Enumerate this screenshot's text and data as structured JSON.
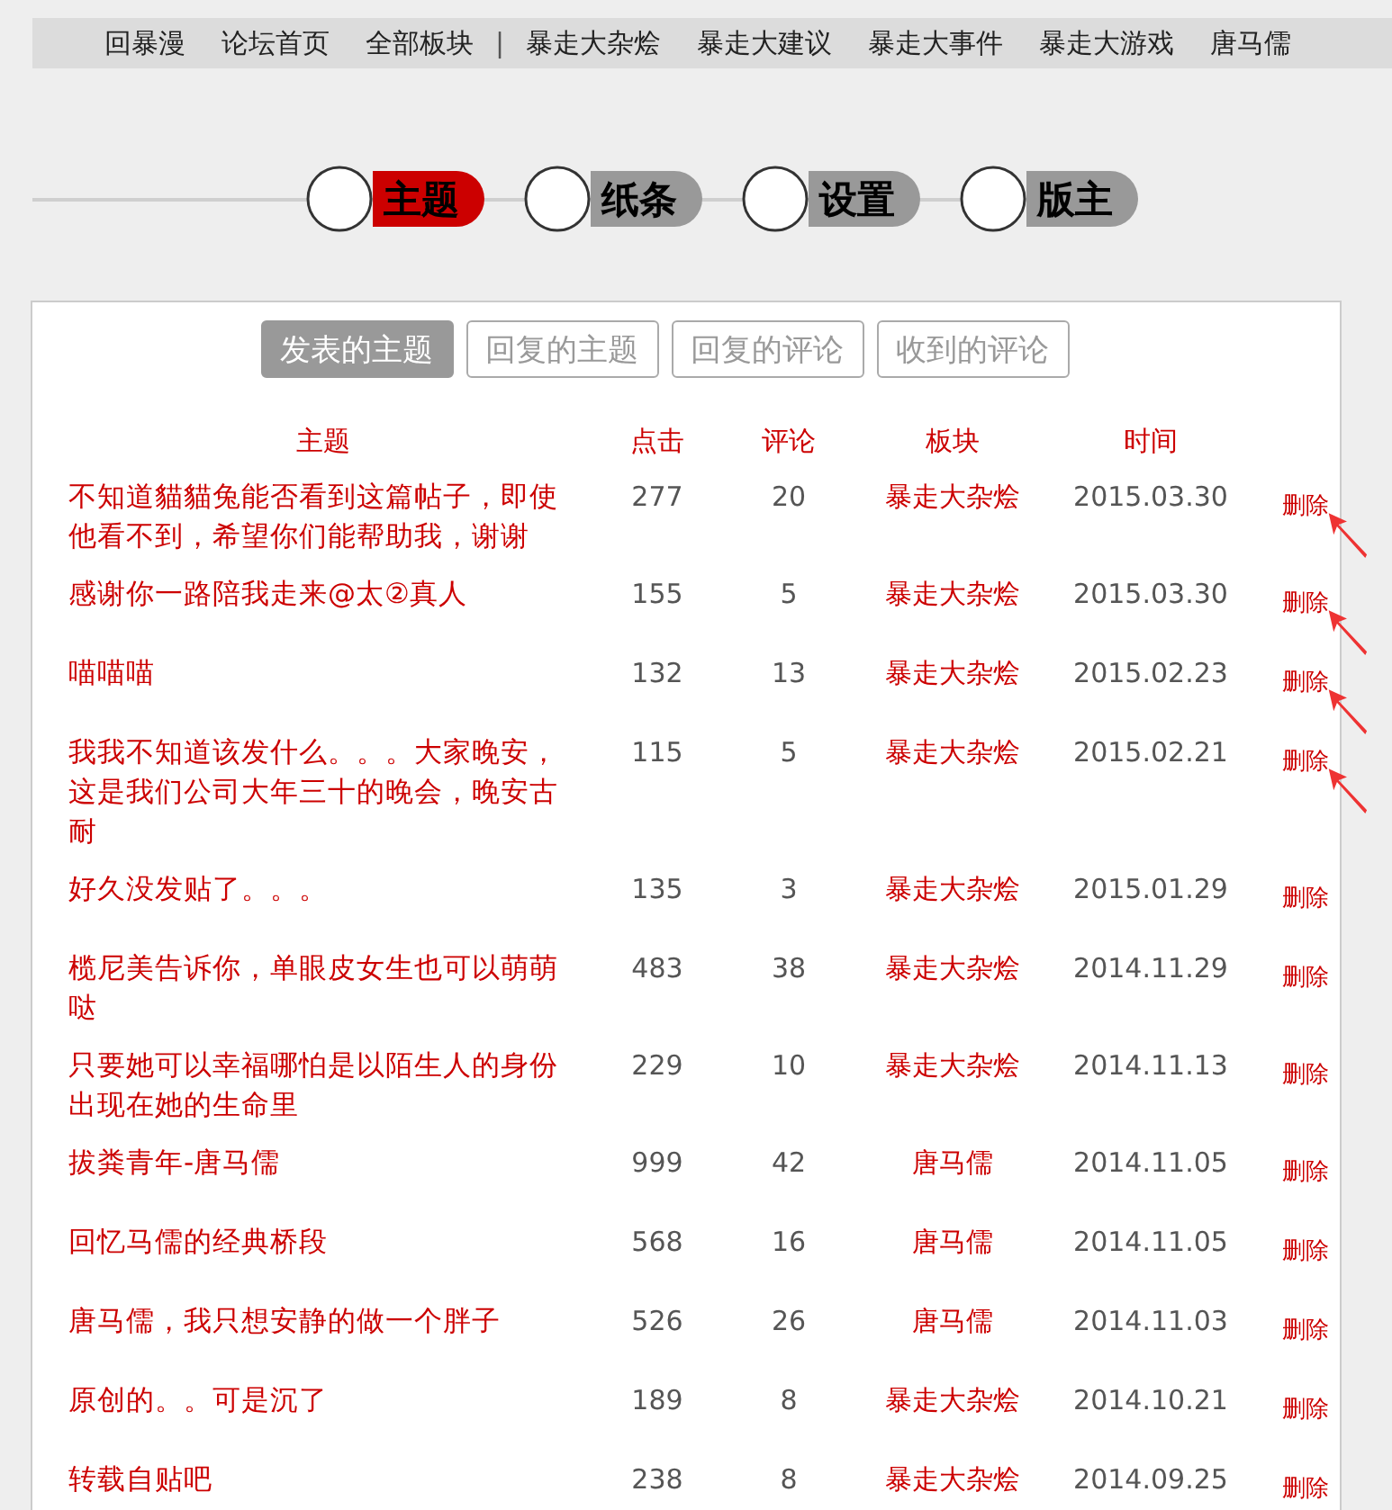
{
  "nav": [
    {
      "kind": "link",
      "label": "回暴漫"
    },
    {
      "kind": "link",
      "label": "论坛首页"
    },
    {
      "kind": "link",
      "label": "全部板块"
    },
    {
      "kind": "separator",
      "label": "|"
    },
    {
      "kind": "link",
      "label": "暴走大杂烩"
    },
    {
      "kind": "link",
      "label": "暴走大建议"
    },
    {
      "kind": "link",
      "label": "暴走大事件"
    },
    {
      "kind": "link",
      "label": "暴走大游戏"
    },
    {
      "kind": "link",
      "label": "唐马儒"
    }
  ],
  "main_tabs": [
    {
      "label": "主题",
      "selected": true
    },
    {
      "label": "纸条",
      "selected": false
    },
    {
      "label": "设置",
      "selected": false
    },
    {
      "label": "版主",
      "selected": false
    }
  ],
  "sub_tabs": [
    {
      "label": "发表的主题",
      "selected": true
    },
    {
      "label": "回复的主题",
      "selected": false
    },
    {
      "label": "回复的评论",
      "selected": false
    },
    {
      "label": "收到的评论",
      "selected": false
    }
  ],
  "table": {
    "columns": [
      "主题",
      "点击",
      "评论",
      "板块",
      "时间"
    ],
    "rows": [
      {
        "title": "不知道貓貓兔能否看到这篇帖子，即使他看不到，希望你们能帮助我，谢谢",
        "clicks": "277",
        "comments": "20",
        "board": "暴走大杂烩",
        "time": "2015.03.30",
        "action": "删除",
        "marked": true
      },
      {
        "title": "感谢你一路陪我走来@太②真人",
        "clicks": "155",
        "comments": "5",
        "board": "暴走大杂烩",
        "time": "2015.03.30",
        "action": "删除",
        "marked": true
      },
      {
        "title": "喵喵喵",
        "clicks": "132",
        "comments": "13",
        "board": "暴走大杂烩",
        "time": "2015.02.23",
        "action": "删除",
        "marked": true
      },
      {
        "title": "我我不知道该发什么。。。大家晚安，这是我们公司大年三十的晚会，晚安古耐",
        "clicks": "115",
        "comments": "5",
        "board": "暴走大杂烩",
        "time": "2015.02.21",
        "action": "删除",
        "marked": true
      },
      {
        "title": "好久没发贴了。。。",
        "clicks": "135",
        "comments": "3",
        "board": "暴走大杂烩",
        "time": "2015.01.29",
        "action": "删除",
        "marked": false
      },
      {
        "title": "榄尼美告诉你，单眼皮女生也可以萌萌哒",
        "clicks": "483",
        "comments": "38",
        "board": "暴走大杂烩",
        "time": "2014.11.29",
        "action": "删除",
        "marked": false
      },
      {
        "title": "只要她可以幸福哪怕是以陌生人的身份出现在她的生命里",
        "clicks": "229",
        "comments": "10",
        "board": "暴走大杂烩",
        "time": "2014.11.13",
        "action": "删除",
        "marked": false
      },
      {
        "title": "拔粪青年-唐马儒",
        "clicks": "999",
        "comments": "42",
        "board": "唐马儒",
        "time": "2014.11.05",
        "action": "删除",
        "marked": false
      },
      {
        "title": "回忆马儒的经典桥段",
        "clicks": "568",
        "comments": "16",
        "board": "唐马儒",
        "time": "2014.11.05",
        "action": "删除",
        "marked": false
      },
      {
        "title": "唐马儒，我只想安静的做一个胖子",
        "clicks": "526",
        "comments": "26",
        "board": "唐马儒",
        "time": "2014.11.03",
        "action": "删除",
        "marked": false
      },
      {
        "title": "原创的。。可是沉了",
        "clicks": "189",
        "comments": "8",
        "board": "暴走大杂烩",
        "time": "2014.10.21",
        "action": "删除",
        "marked": false
      },
      {
        "title": "转载自贴吧",
        "clicks": "238",
        "comments": "8",
        "board": "暴走大杂烩",
        "time": "2014.09.25",
        "action": "删除",
        "marked": false
      }
    ]
  }
}
